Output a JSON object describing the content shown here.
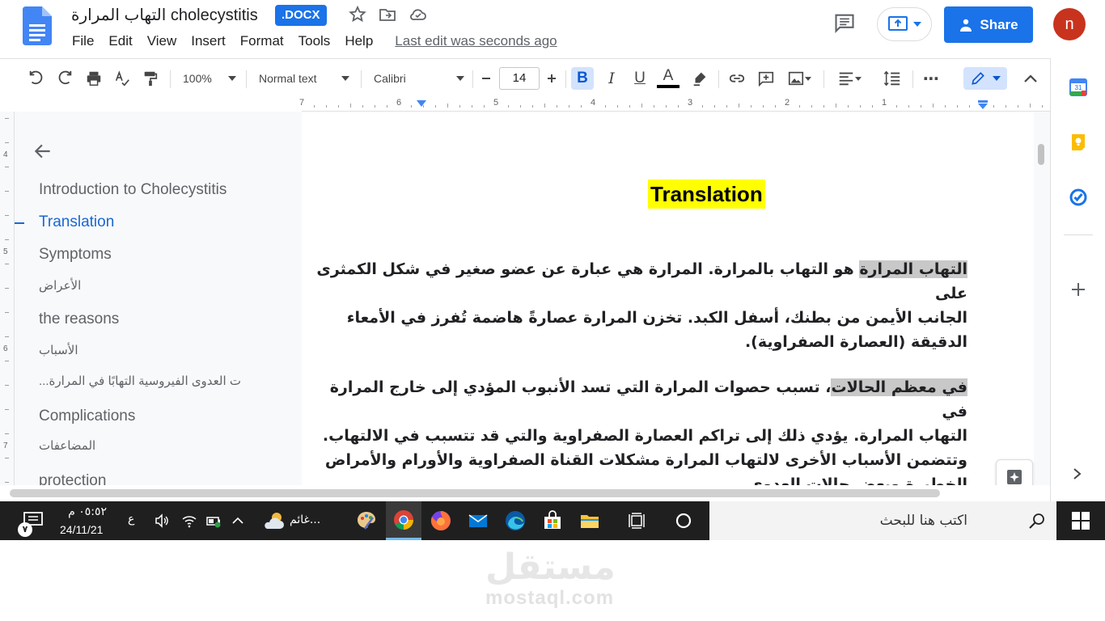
{
  "header": {
    "title": "التهاب المرارة cholecystitis",
    "file_badge": ".DOCX",
    "menu": [
      "File",
      "Edit",
      "View",
      "Insert",
      "Format",
      "Tools",
      "Help"
    ],
    "last_edit": "Last edit was seconds ago",
    "share_label": "Share",
    "avatar_initial": "n"
  },
  "toolbar": {
    "zoom": "100%",
    "style": "Normal text",
    "font": "Calibri",
    "font_size": "14",
    "bold_label": "B",
    "italic_label": "I",
    "underline_label": "U",
    "text_color_label": "A",
    "more": "⋯"
  },
  "ruler": {
    "numbers": [
      "7",
      "6",
      "5",
      "4",
      "3",
      "2",
      "1"
    ]
  },
  "vertical_ruler": [
    "4",
    "5",
    "6",
    "7"
  ],
  "outline": {
    "items": [
      {
        "label": "Introduction to Cholecystitis",
        "level": "h"
      },
      {
        "label": "Translation",
        "level": "h",
        "active": true
      },
      {
        "label": "Symptoms",
        "level": "h"
      },
      {
        "label": "الأعراض",
        "level": "sub"
      },
      {
        "label": "the reasons",
        "level": "h"
      },
      {
        "label": "الأسباب",
        "level": "sub"
      },
      {
        "label": "...ت العدوى الفيروسية التهابًا في المرارة",
        "level": "sub"
      },
      {
        "label": "Complications",
        "level": "h"
      },
      {
        "label": "المضاعفات",
        "level": "sub"
      },
      {
        "label": "protection",
        "level": "h"
      }
    ]
  },
  "document": {
    "heading": "Translation",
    "p1_highlight": "التهاب المرارة",
    "p1_line1_rest": " هو التهاب بالمرارة. المرارة هي عبارة عن عضو صغير في شكل الكمثرى على",
    "p1_line2": "الجانب الأيمن من بطنك، أسفل الكبد. تخزن المرارة عصارةً هاضمة تُفرز في الأمعاء",
    "p1_line3": "الدقيقة (العصارة الصفراوية).",
    "p2_highlight": "في معظم الحالات",
    "p2_line1_rest": "، تسبب حصوات المرارة التي تسد الأنبوب المؤدي إلى خارج المرارة في",
    "p2_line2": "التهاب المرارة. يؤدي ذلك إلى تراكم العصارة الصفراوية والتي قد تتسبب في الالتهاب.",
    "p2_line3": "وتتضمن الأسباب الأخرى لالتهاب المرارة مشكلات القناة الصفراوية والأورام والأمراض",
    "p2_line4": "الخطيرة وبعض حالات العدوى"
  },
  "taskbar": {
    "search_placeholder": "اكتب هنا للبحث",
    "weather": "غائم...",
    "time": "٠٥:٥٢ م",
    "date": "24/11/21",
    "lang": "ع",
    "notification_count": "٧"
  },
  "watermark": {
    "logo": "مستقل",
    "url": "mostaql.com"
  },
  "colors": {
    "accent": "#1a73e8",
    "avatar": "#c8331e",
    "highlight_yellow": "#ffff00",
    "highlight_gray": "#c8c8c8",
    "taskbar": "#1f1f1f"
  }
}
